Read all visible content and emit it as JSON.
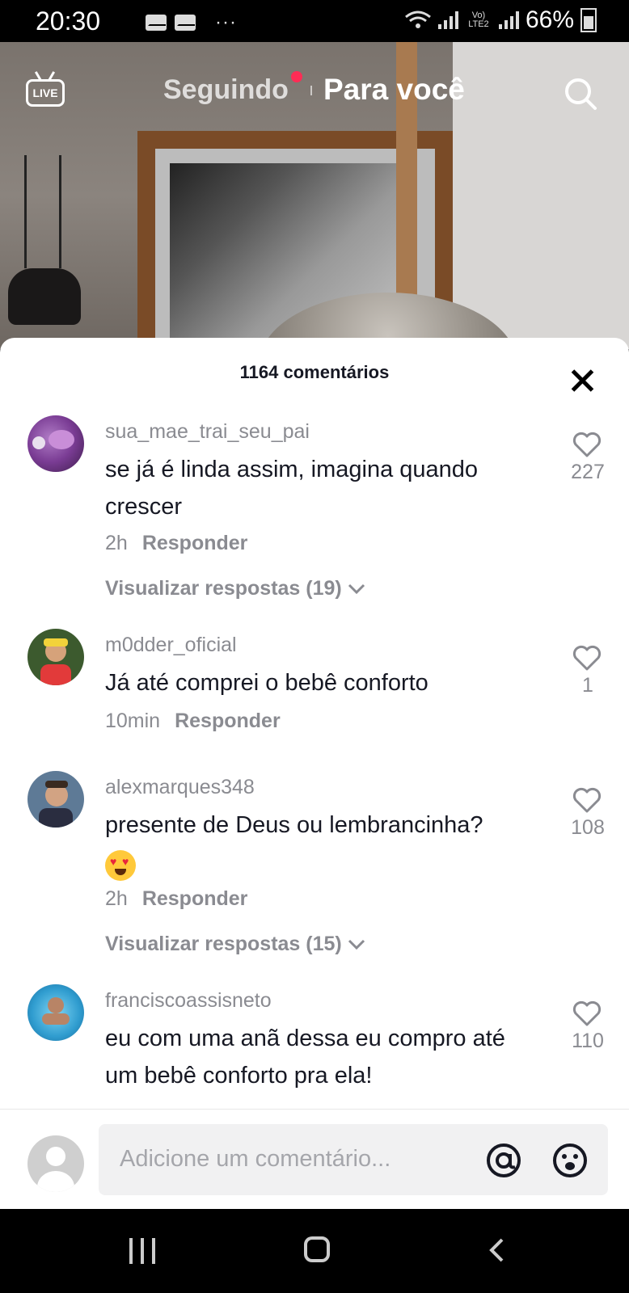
{
  "status_bar": {
    "time": "20:30",
    "dots": "···",
    "network": "Vo) LTE2",
    "battery": "66%"
  },
  "top_nav": {
    "live_label": "LIVE",
    "following": "Seguindo",
    "for_you": "Para você"
  },
  "comments_sheet": {
    "title": "1164 comentários",
    "comments": [
      {
        "username": "sua_mae_trai_seu_pai",
        "text": "se já é linda assim, imagina quando crescer",
        "time": "2h",
        "reply_label": "Responder",
        "likes": "227",
        "view_replies": "Visualizar respostas (19)"
      },
      {
        "username": "m0dder_oficial",
        "text": "Já até comprei o bebê conforto",
        "time": "10min",
        "reply_label": "Responder",
        "likes": "1"
      },
      {
        "username": "alexmarques348",
        "text": "presente de Deus ou lembrancinha?",
        "time": "2h",
        "reply_label": "Responder",
        "likes": "108",
        "view_replies": "Visualizar respostas (15)"
      },
      {
        "username": "franciscoassisneto",
        "text": "eu com uma anã dessa eu compro até um bebê conforto pra ela!",
        "likes": "110"
      }
    ]
  },
  "input_bar": {
    "placeholder": "Adicione um comentário..."
  },
  "colors": {
    "accent_red": "#fe2c55",
    "text_dark": "#161823",
    "text_gray": "#8a8b91"
  }
}
